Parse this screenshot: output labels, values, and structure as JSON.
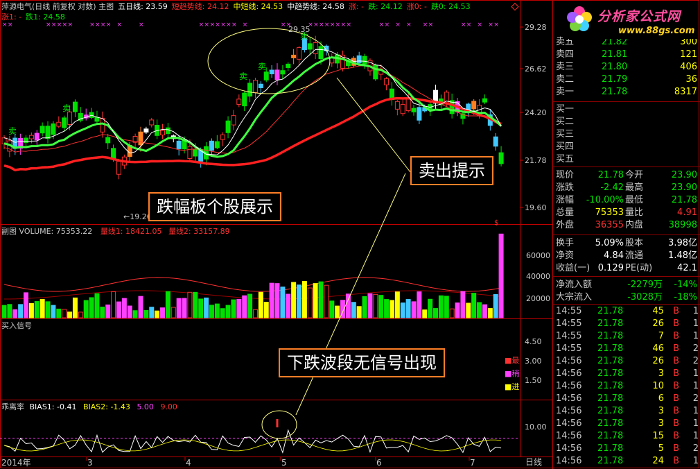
{
  "header": {
    "title": "萍源电气(日线 前复权 对数) 主图",
    "items": [
      {
        "t": "五日线: 23.59",
        "c": "#ffffff"
      },
      {
        "t": "短趋势线: 24.12",
        "c": "#ff3030"
      },
      {
        "t": "中短线: 24.53",
        "c": "#ffff00"
      },
      {
        "t": "中趋势线: 24.58",
        "c": "#ffffff"
      },
      {
        "t": "涨: -",
        "c": "#ff3030"
      },
      {
        "t": "跌: 24.12",
        "c": "#00e000"
      },
      {
        "t": "涨0: -",
        "c": "#ff3030"
      },
      {
        "t": "跌0: 24.53",
        "c": "#00e000"
      }
    ]
  },
  "header2": [
    {
      "t": "涨1: -",
      "c": "#ff3030"
    },
    {
      "t": "跌1: 24.58",
      "c": "#00e000"
    }
  ],
  "price_axis": [
    "29.28",
    "26.62",
    "24.20",
    "21.78",
    "19.60"
  ],
  "price_marks": {
    "high": "29.35",
    "low": "19.26",
    "sell": "卖",
    "buy": "买"
  },
  "vol_header": {
    "title": "副图 VOLUME: 75353.22",
    "ma1": "量线1: 18421.05",
    "ma2": "量线2: 33157.89"
  },
  "vol_axis": [
    "60000",
    "40000",
    "20000"
  ],
  "sig_header": "买入信号",
  "sig_axis": [
    "4.50",
    "3.00",
    "1.50"
  ],
  "sig_legend": [
    {
      "t": "最",
      "c": "#ff3030"
    },
    {
      "t": "稍",
      "c": "#ff40ff"
    },
    {
      "t": "进",
      "c": "#ffff00"
    }
  ],
  "bias_header": {
    "title": "乖离率",
    "b1": "BIAS1: -0.41",
    "b2": "BIAS2: -1.43",
    "v1": "5.00",
    "v2": "9.00"
  },
  "bias_axis": [
    "10.00"
  ],
  "date_axis": [
    "2014年",
    "3",
    "4",
    "5",
    "6",
    "7"
  ],
  "period": "日线",
  "annotations": {
    "a1": "跌幅板个股展示",
    "a2": "卖出提示",
    "a3": "下跌波段无信号出现"
  },
  "logo": {
    "title": "分析家公式网",
    "url": "www.88gs.com"
  },
  "orderbook": {
    "sell": [
      {
        "l": "卖五",
        "p": "21.82",
        "v": "300"
      },
      {
        "l": "卖四",
        "p": "21.81",
        "v": "121"
      },
      {
        "l": "卖三",
        "p": "21.80",
        "v": "406"
      },
      {
        "l": "卖二",
        "p": "21.79",
        "v": "36"
      },
      {
        "l": "卖一",
        "p": "21.78",
        "v": "8317"
      }
    ],
    "buy": [
      {
        "l": "买一"
      },
      {
        "l": "买二"
      },
      {
        "l": "买三"
      },
      {
        "l": "买四"
      },
      {
        "l": "买五"
      }
    ]
  },
  "quote": [
    {
      "l1": "现价",
      "v1": "21.78",
      "c1": "#00e000",
      "l2": "今开",
      "v2": "23.90",
      "c2": "#00e000"
    },
    {
      "l1": "涨跌",
      "v1": "-2.42",
      "c1": "#00e000",
      "l2": "最高",
      "v2": "23.90",
      "c2": "#00e000"
    },
    {
      "l1": "涨幅",
      "v1": "-10.00%",
      "c1": "#00e000",
      "l2": "最低",
      "v2": "21.78",
      "c2": "#00e000"
    },
    {
      "l1": "总量",
      "v1": "75353",
      "c1": "#ffff00",
      "l2": "量比",
      "v2": "4.91",
      "c2": "#ff3030"
    },
    {
      "l1": "外盘",
      "v1": "36355",
      "c1": "#ff3030",
      "l2": "内盘",
      "v2": "38998",
      "c2": "#00e000"
    }
  ],
  "stats": [
    {
      "l1": "换手",
      "v1": "5.09%",
      "c1": "#ffffff",
      "l2": "股本",
      "v2": "3.98亿",
      "c2": "#ffffff"
    },
    {
      "l1": "净资",
      "v1": "4.84",
      "c1": "#ffffff",
      "l2": "流通",
      "v2": "1.48亿",
      "c2": "#ffffff"
    },
    {
      "l1": "收益(一)",
      "v1": "0.129",
      "c1": "#ffffff",
      "l2": "PE(动)",
      "v2": "42.1",
      "c2": "#ffffff"
    }
  ],
  "flows": [
    {
      "l": "净流入额",
      "v": "-2279万",
      "p": "-14%"
    },
    {
      "l": "大宗流入",
      "v": "-3028万",
      "p": "-18%"
    }
  ],
  "ticks": [
    {
      "t": "14:55",
      "p": "21.78",
      "v": "45",
      "s": "B",
      "n": "1"
    },
    {
      "t": "14:55",
      "p": "21.78",
      "v": "26",
      "s": "B",
      "n": "1"
    },
    {
      "t": "14:55",
      "p": "21.78",
      "v": "7",
      "s": "B",
      "n": "1"
    },
    {
      "t": "14:55",
      "p": "21.78",
      "v": "46",
      "s": "B",
      "n": "2"
    },
    {
      "t": "14:56",
      "p": "21.78",
      "v": "26",
      "s": "B",
      "n": "2"
    },
    {
      "t": "14:56",
      "p": "21.78",
      "v": "3",
      "s": "B",
      "n": "1"
    },
    {
      "t": "14:56",
      "p": "21.78",
      "v": "10",
      "s": "B",
      "n": "1"
    },
    {
      "t": "14:56",
      "p": "21.78",
      "v": "6",
      "s": "B",
      "n": "2"
    },
    {
      "t": "14:56",
      "p": "21.78",
      "v": "3",
      "s": "B",
      "n": "1"
    },
    {
      "t": "14:56",
      "p": "21.78",
      "v": "3",
      "s": "B",
      "n": "1"
    },
    {
      "t": "14:56",
      "p": "21.78",
      "v": "15",
      "s": "B",
      "n": "1"
    },
    {
      "t": "14:56",
      "p": "21.78",
      "v": "5",
      "s": "B",
      "n": "2"
    },
    {
      "t": "14:56",
      "p": "21.78",
      "v": "24",
      "s": "B",
      "n": "1"
    }
  ],
  "colors": {
    "up": "#ff3030",
    "down": "#00e000",
    "grid": "#8b0000",
    "axis": "#c00000"
  }
}
